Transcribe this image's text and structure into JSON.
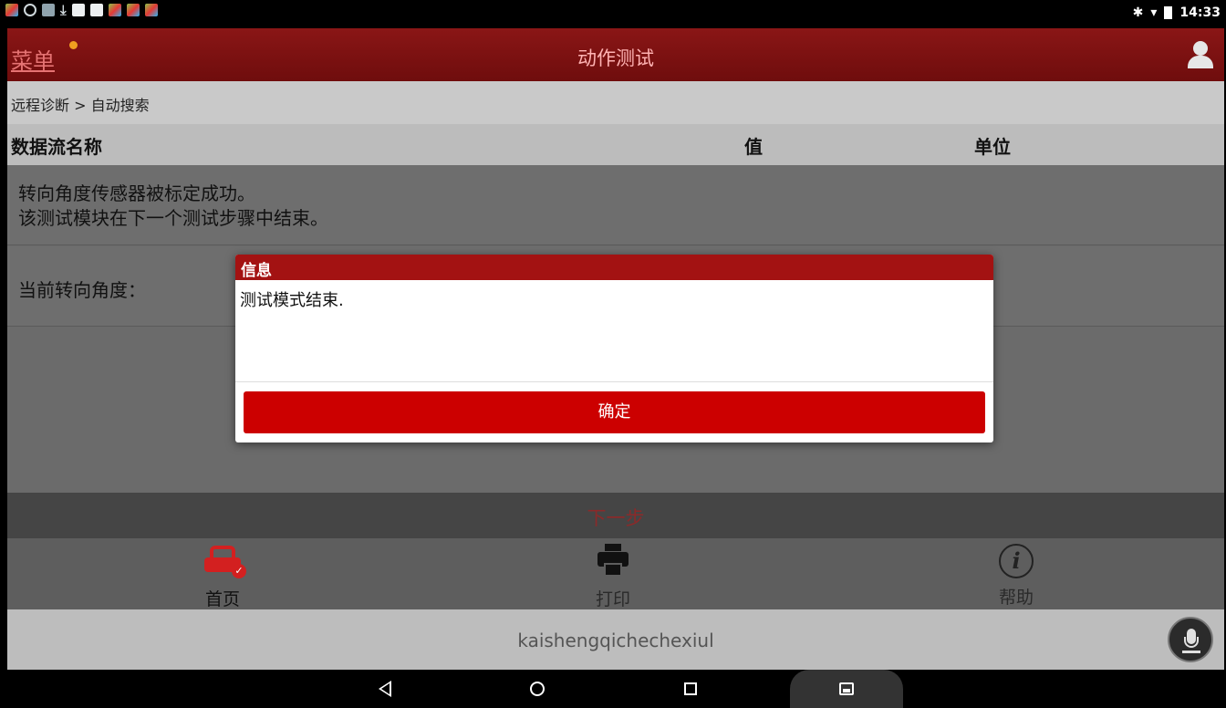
{
  "statusbar": {
    "time": "14:33",
    "bt": "✱",
    "wifi": "▾"
  },
  "header": {
    "menu_label": "菜单",
    "title": "动作测试"
  },
  "breadcrumb": "远程诊断 > 自动搜索",
  "table": {
    "columns": [
      "数据流名称",
      "值",
      "单位"
    ],
    "message_lines": [
      "转向角度传感器被标定成功。",
      "该测试模块在下一个测试步骤中结束。"
    ],
    "angle_label": "当前转向角度："
  },
  "next_label": "下一步",
  "bottom_nav": {
    "home": "首页",
    "print": "打印",
    "help": "帮助"
  },
  "search_text": "kaishengqichechexiul",
  "dialog": {
    "title": "信息",
    "message": "测试模式结束.",
    "ok_label": "确定"
  },
  "colors": {
    "header_red": "#8a1616",
    "button_red": "#cc0000",
    "dialog_title_red": "#a31212"
  }
}
